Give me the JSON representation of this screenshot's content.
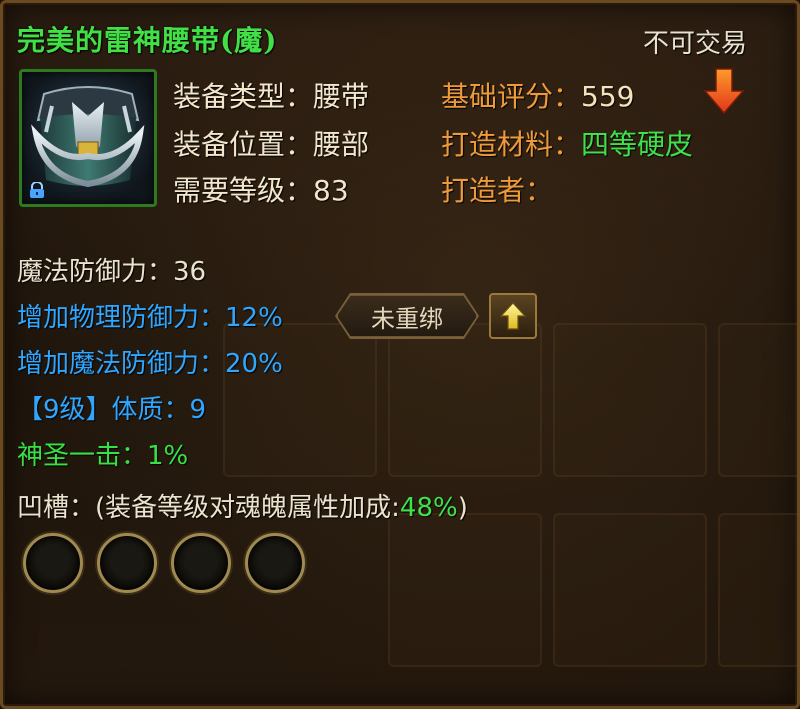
{
  "item": {
    "name": "完美的雷神腰带(魔)",
    "trade_status": "不可交易",
    "icon": "belt-armor-icon",
    "locked_icon": "lock-icon"
  },
  "attributes": {
    "type_label": "装备类型：",
    "type_value": "腰带",
    "position_label": "装备位置：",
    "position_value": "腰部",
    "level_label": "需要等级：",
    "level_value": "83",
    "score_label": "基础评分：",
    "score_value": "559",
    "score_trend": "down-arrow-icon",
    "material_label": "打造材料：",
    "material_value": "四等硬皮",
    "maker_label": "打造者：",
    "maker_value": ""
  },
  "stats": {
    "magic_def": "魔法防御力：36",
    "phys_def_bonus": "增加物理防御力：12%",
    "magic_def_bonus": "增加魔法防御力：20%",
    "constitution": "【9级】体质：9",
    "holy_strike": "神圣一击：1%",
    "socket_label": "凹槽：(装备等级对魂魄属性加成:",
    "socket_pct": "48%",
    "socket_close": ")"
  },
  "buttons": {
    "rebind_label": "未重绑",
    "upgrade_icon": "up-arrow-icon"
  },
  "sockets": [
    "empty",
    "empty",
    "empty",
    "empty"
  ],
  "colors": {
    "title_green": "#42e046",
    "orange_label": "#ef9a3a",
    "blue_stat": "#2fa6ff",
    "green_stat": "#38e045"
  }
}
